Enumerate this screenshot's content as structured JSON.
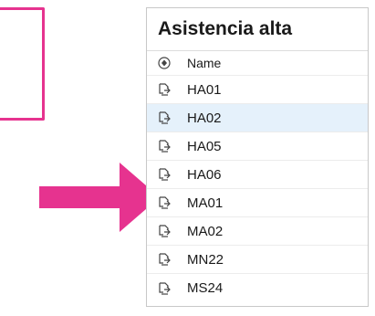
{
  "panel": {
    "title": "Asistencia alta",
    "header": {
      "icon": "add-circle-icon",
      "label": "Name"
    },
    "items": [
      {
        "label": "HA01",
        "icon": "resource-icon",
        "selected": false
      },
      {
        "label": "HA02",
        "icon": "resource-icon",
        "selected": true
      },
      {
        "label": "HA05",
        "icon": "resource-icon",
        "selected": false
      },
      {
        "label": "HA06",
        "icon": "resource-icon",
        "selected": false
      },
      {
        "label": "MA01",
        "icon": "resource-icon",
        "selected": false
      },
      {
        "label": "MA02",
        "icon": "resource-icon",
        "selected": false
      },
      {
        "label": "MN22",
        "icon": "resource-icon",
        "selected": false
      },
      {
        "label": "MS24",
        "icon": "resource-icon",
        "selected": false
      }
    ]
  },
  "colors": {
    "annotation": "#e6338f",
    "selected_row": "#e5f1fb"
  }
}
